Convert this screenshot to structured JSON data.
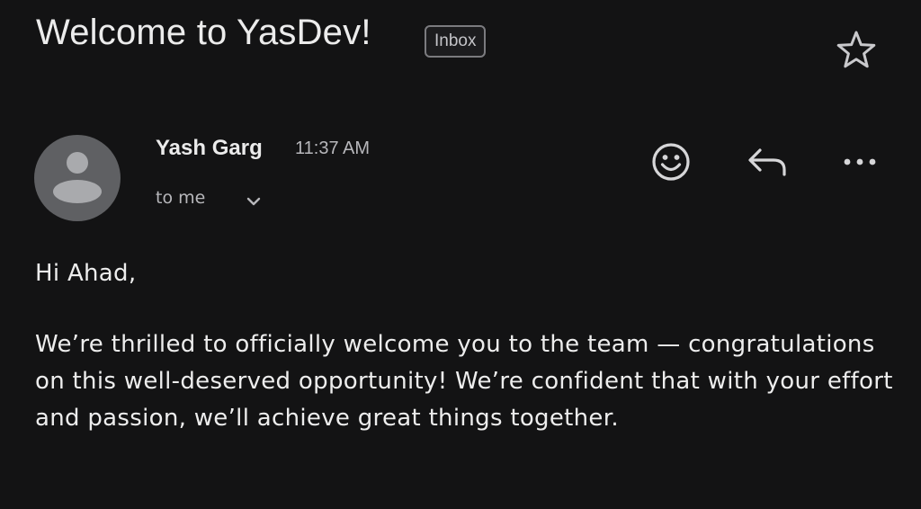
{
  "email": {
    "subject": "Welcome to YasDev!",
    "label": "Inbox",
    "sender": {
      "name": "Yash Garg",
      "time": "11:37 AM",
      "recipient_text": "to me"
    },
    "body": {
      "greeting": "Hi Ahad,",
      "paragraph": "We’re thrilled to officially welcome you to the team — congratulations on this well-deserved opportunity! We’re confident that with your effort and passion, we’ll achieve great things together."
    }
  },
  "icons": {
    "star": "star-outline-icon",
    "emoji": "smiley-face-icon",
    "reply": "reply-arrow-icon",
    "more": "more-horizontal-icon",
    "chevron": "chevron-down-icon",
    "avatar": "default-person-avatar"
  },
  "colors": {
    "background": "#131314",
    "text_primary": "#ececec",
    "text_secondary": "#b7b7bb",
    "avatar_bg": "#5f6063",
    "avatar_fg": "#a9aaad"
  }
}
